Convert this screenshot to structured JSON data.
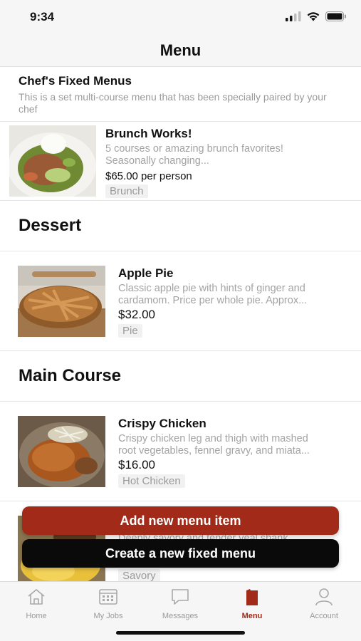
{
  "status_bar": {
    "time": "9:34"
  },
  "nav": {
    "title": "Menu"
  },
  "fixed_menus": {
    "title": "Chef's Fixed Menus",
    "subtitle": "This is a set multi-course menu that has been specially paired by your chef",
    "items": [
      {
        "name": "Brunch Works!",
        "description_1": "5 courses or amazing brunch favorites!",
        "description_2": "Seasonally changing...",
        "price": "$65.00 per person",
        "tag": "Brunch"
      }
    ]
  },
  "sections": [
    {
      "title": "Dessert",
      "items": [
        {
          "name": "Apple Pie",
          "description_1": "Classic apple pie with hints of ginger and",
          "description_2": "cardamom. Price per whole pie. Approx...",
          "price": "$32.00",
          "tag": "Pie"
        }
      ]
    },
    {
      "title": "Main Course",
      "items": [
        {
          "name": "Crispy Chicken",
          "description_1": "Crispy chicken leg and thigh with mashed",
          "description_2": "root vegetables, fennel gravy, and miata...",
          "price": "$16.00",
          "tag": "Hot Chicken"
        },
        {
          "description_1": "Deeply savory and tender veal shank",
          "tag": "Savory"
        }
      ]
    }
  ],
  "actions": {
    "add_item": "Add new menu item",
    "create_fixed": "Create a new fixed menu"
  },
  "tabs": [
    {
      "label": "Home",
      "icon": "home-icon",
      "active": false
    },
    {
      "label": "My Jobs",
      "icon": "calendar-icon",
      "active": false
    },
    {
      "label": "Messages",
      "icon": "message-icon",
      "active": false
    },
    {
      "label": "Menu",
      "icon": "menu-book-icon",
      "active": true
    },
    {
      "label": "Account",
      "icon": "person-icon",
      "active": false
    }
  ],
  "colors": {
    "accent": "#a22a18",
    "dark_button": "#0a0a0a",
    "muted_text": "#9a9a9a"
  }
}
